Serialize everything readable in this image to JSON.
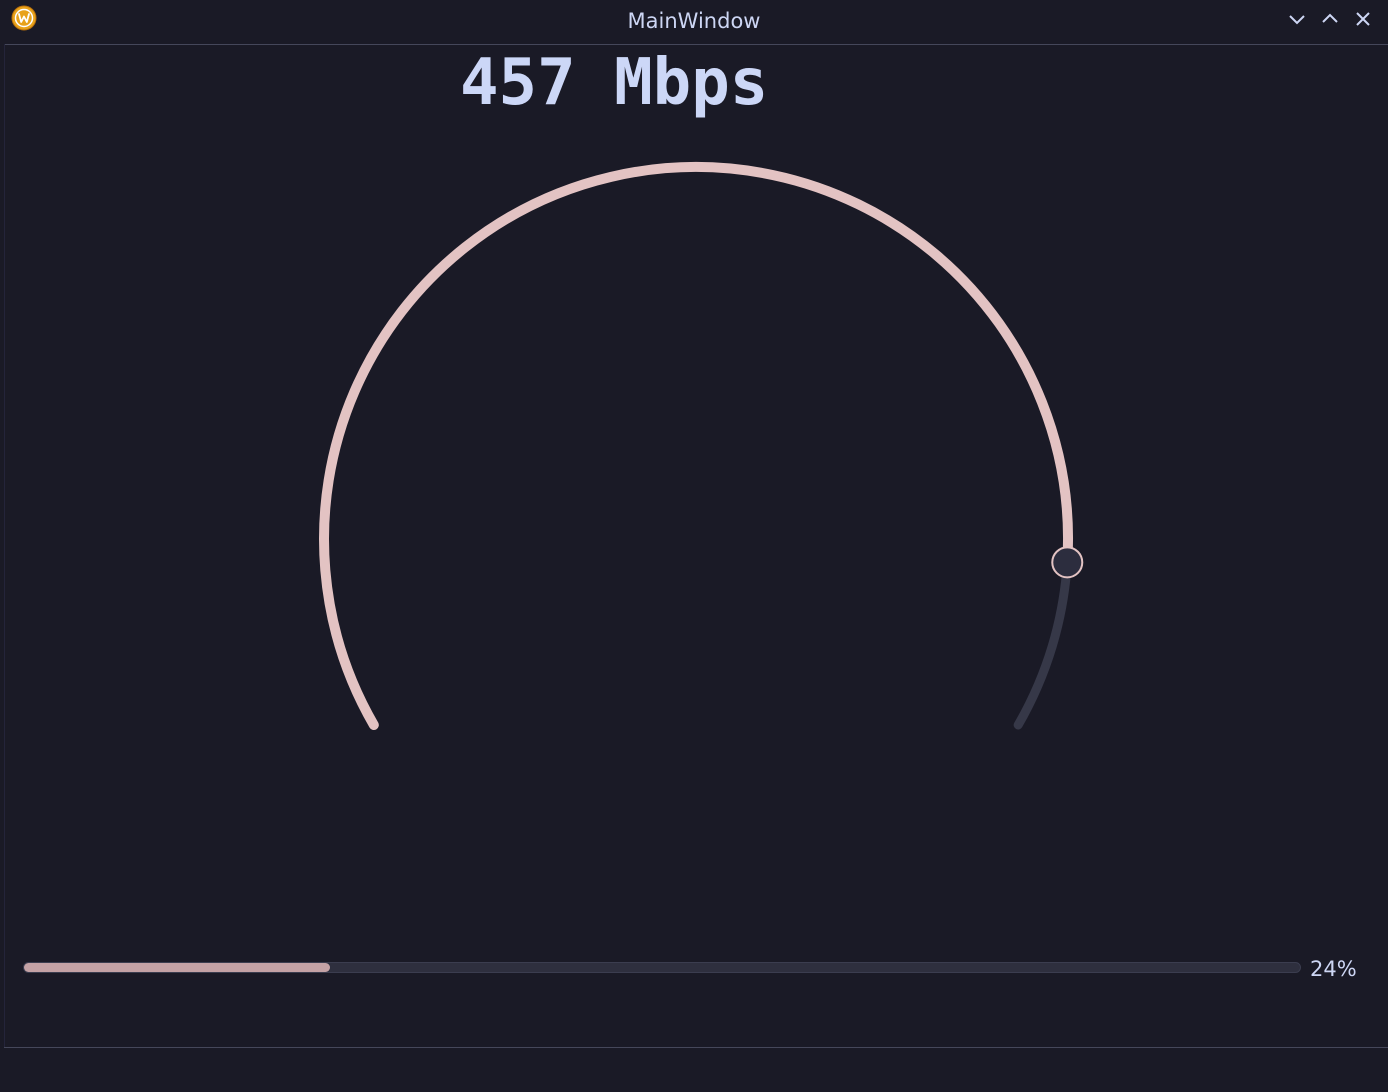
{
  "window": {
    "title": "MainWindow",
    "icons": {
      "app": "app-logo-icon",
      "minimize": "chevron-down-icon",
      "maximize": "chevron-up-icon",
      "close": "close-icon"
    }
  },
  "speed": {
    "label": "457 Mbps"
  },
  "dial": {
    "value_fraction": 0.89,
    "colors": {
      "active": "#e3c3c3",
      "inactive": "#363848",
      "handle_fill": "#2c2d3e",
      "handle_stroke": "#e3c3c3"
    }
  },
  "progress": {
    "value_percent": 24,
    "text": "24%",
    "colors": {
      "fill": "#c4a2a5",
      "track": "#2e2f3e"
    }
  },
  "colors": {
    "background": "#1a1a26",
    "text": "#cdd6f4",
    "app_icon": "#e8a21a"
  }
}
